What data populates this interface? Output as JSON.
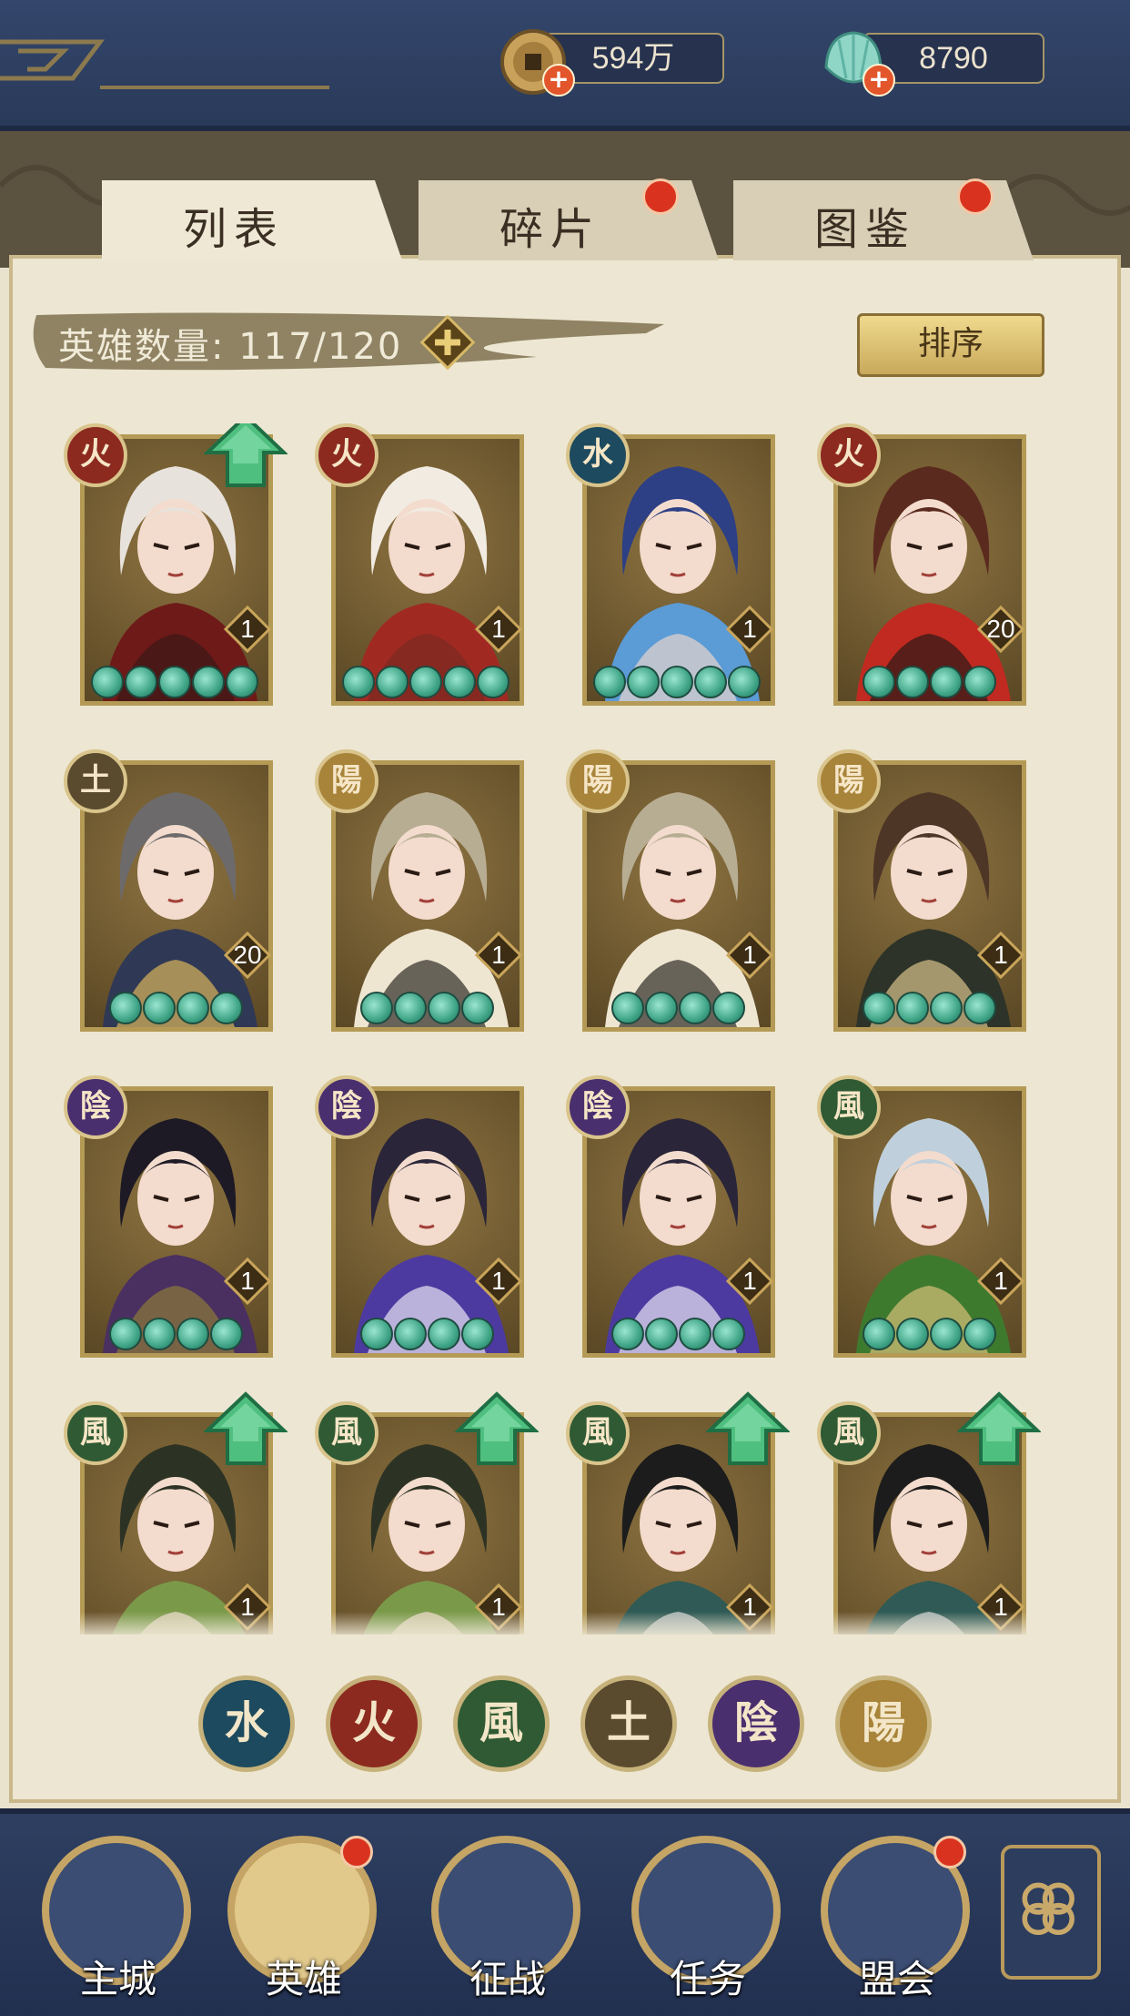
{
  "resources": {
    "coins": "594万",
    "jade": "8790"
  },
  "tabs": [
    {
      "label": "列表",
      "active": true,
      "dot": false
    },
    {
      "label": "碎片",
      "active": false,
      "dot": true
    },
    {
      "label": "图鉴",
      "active": false,
      "dot": true
    }
  ],
  "hero_count": "英雄数量: 117/120",
  "sort_label": "排序",
  "colors": {
    "fire": "#8c2a1f",
    "water": "#1d4a5e",
    "earth": "#5a4a2e",
    "yang": "#a8843a",
    "yin": "#4a2f6e",
    "wind": "#2f5a33"
  },
  "heroes": [
    {
      "element": "fire",
      "glyph": "火",
      "level": "1",
      "stars": 5,
      "upgrade": true,
      "palette": [
        "#e8e2dc",
        "#6e1a18",
        "#3a1815"
      ]
    },
    {
      "element": "fire",
      "glyph": "火",
      "level": "1",
      "stars": 5,
      "upgrade": false,
      "palette": [
        "#f2ebe2",
        "#a02a22",
        "#7b2a21"
      ]
    },
    {
      "element": "water",
      "glyph": "水",
      "level": "1",
      "stars": 5,
      "upgrade": false,
      "palette": [
        "#2d3f85",
        "#5b9bd6",
        "#e7d6cc"
      ]
    },
    {
      "element": "fire",
      "glyph": "火",
      "level": "20",
      "stars": 4,
      "upgrade": false,
      "palette": [
        "#5b2a1e",
        "#c12a20",
        "#2a1a18"
      ]
    },
    {
      "element": "earth",
      "glyph": "土",
      "level": "20",
      "stars": 4,
      "upgrade": false,
      "palette": [
        "#6d6a6b",
        "#2f3855",
        "#d9b55a"
      ]
    },
    {
      "element": "yang",
      "glyph": "陽",
      "level": "1",
      "stars": 4,
      "upgrade": false,
      "palette": [
        "#b7ad93",
        "#efe6d2",
        "#2f2b24"
      ]
    },
    {
      "element": "yang",
      "glyph": "陽",
      "level": "1",
      "stars": 4,
      "upgrade": false,
      "palette": [
        "#b7ad93",
        "#efe6d2",
        "#2f2b24"
      ]
    },
    {
      "element": "yang",
      "glyph": "陽",
      "level": "1",
      "stars": 4,
      "upgrade": false,
      "palette": [
        "#4d3626",
        "#2d3328",
        "#d7c08a"
      ]
    },
    {
      "element": "yin",
      "glyph": "陰",
      "level": "1",
      "stars": 4,
      "upgrade": false,
      "palette": [
        "#1d1a25",
        "#4a3060",
        "#8c7a3a"
      ]
    },
    {
      "element": "yin",
      "glyph": "陰",
      "level": "1",
      "stars": 4,
      "upgrade": false,
      "palette": [
        "#2a2538",
        "#4c3aa0",
        "#e9e6f2"
      ]
    },
    {
      "element": "yin",
      "glyph": "陰",
      "level": "1",
      "stars": 4,
      "upgrade": false,
      "palette": [
        "#2a2538",
        "#4c3aa0",
        "#e9e6f2"
      ]
    },
    {
      "element": "wind",
      "glyph": "風",
      "level": "1",
      "stars": 4,
      "upgrade": false,
      "palette": [
        "#bfd0dc",
        "#3e7a2e",
        "#d8c07a"
      ]
    },
    {
      "element": "wind",
      "glyph": "風",
      "level": "1",
      "stars": 0,
      "upgrade": true,
      "palette": [
        "#2d3324",
        "#7a9a4a",
        "#f2ddd0"
      ]
    },
    {
      "element": "wind",
      "glyph": "風",
      "level": "1",
      "stars": 0,
      "upgrade": true,
      "palette": [
        "#2d3324",
        "#7a9a4a",
        "#f2ddd0"
      ]
    },
    {
      "element": "wind",
      "glyph": "風",
      "level": "1",
      "stars": 0,
      "upgrade": true,
      "palette": [
        "#1c1c1c",
        "#2f5a55",
        "#d9d9d9"
      ]
    },
    {
      "element": "wind",
      "glyph": "風",
      "level": "1",
      "stars": 0,
      "upgrade": true,
      "palette": [
        "#1c1c1c",
        "#2f5a55",
        "#d9d9d9"
      ]
    }
  ],
  "filters": [
    {
      "element": "water",
      "glyph": "水"
    },
    {
      "element": "fire",
      "glyph": "火"
    },
    {
      "element": "wind",
      "glyph": "風"
    },
    {
      "element": "earth",
      "glyph": "土"
    },
    {
      "element": "yin",
      "glyph": "陰"
    },
    {
      "element": "yang",
      "glyph": "陽"
    }
  ],
  "nav": [
    {
      "label": "主城",
      "icon": "city-gate-icon",
      "dot": false
    },
    {
      "label": "英雄",
      "icon": "hero-portrait-icon",
      "dot": true
    },
    {
      "label": "征战",
      "icon": "war-horn-icon",
      "dot": false
    },
    {
      "label": "任务",
      "icon": "task-scroll-icon",
      "dot": false
    },
    {
      "label": "盟会",
      "icon": "alliance-gate-icon",
      "dot": true
    }
  ],
  "nav_more_icon": "menu-flower-icon"
}
